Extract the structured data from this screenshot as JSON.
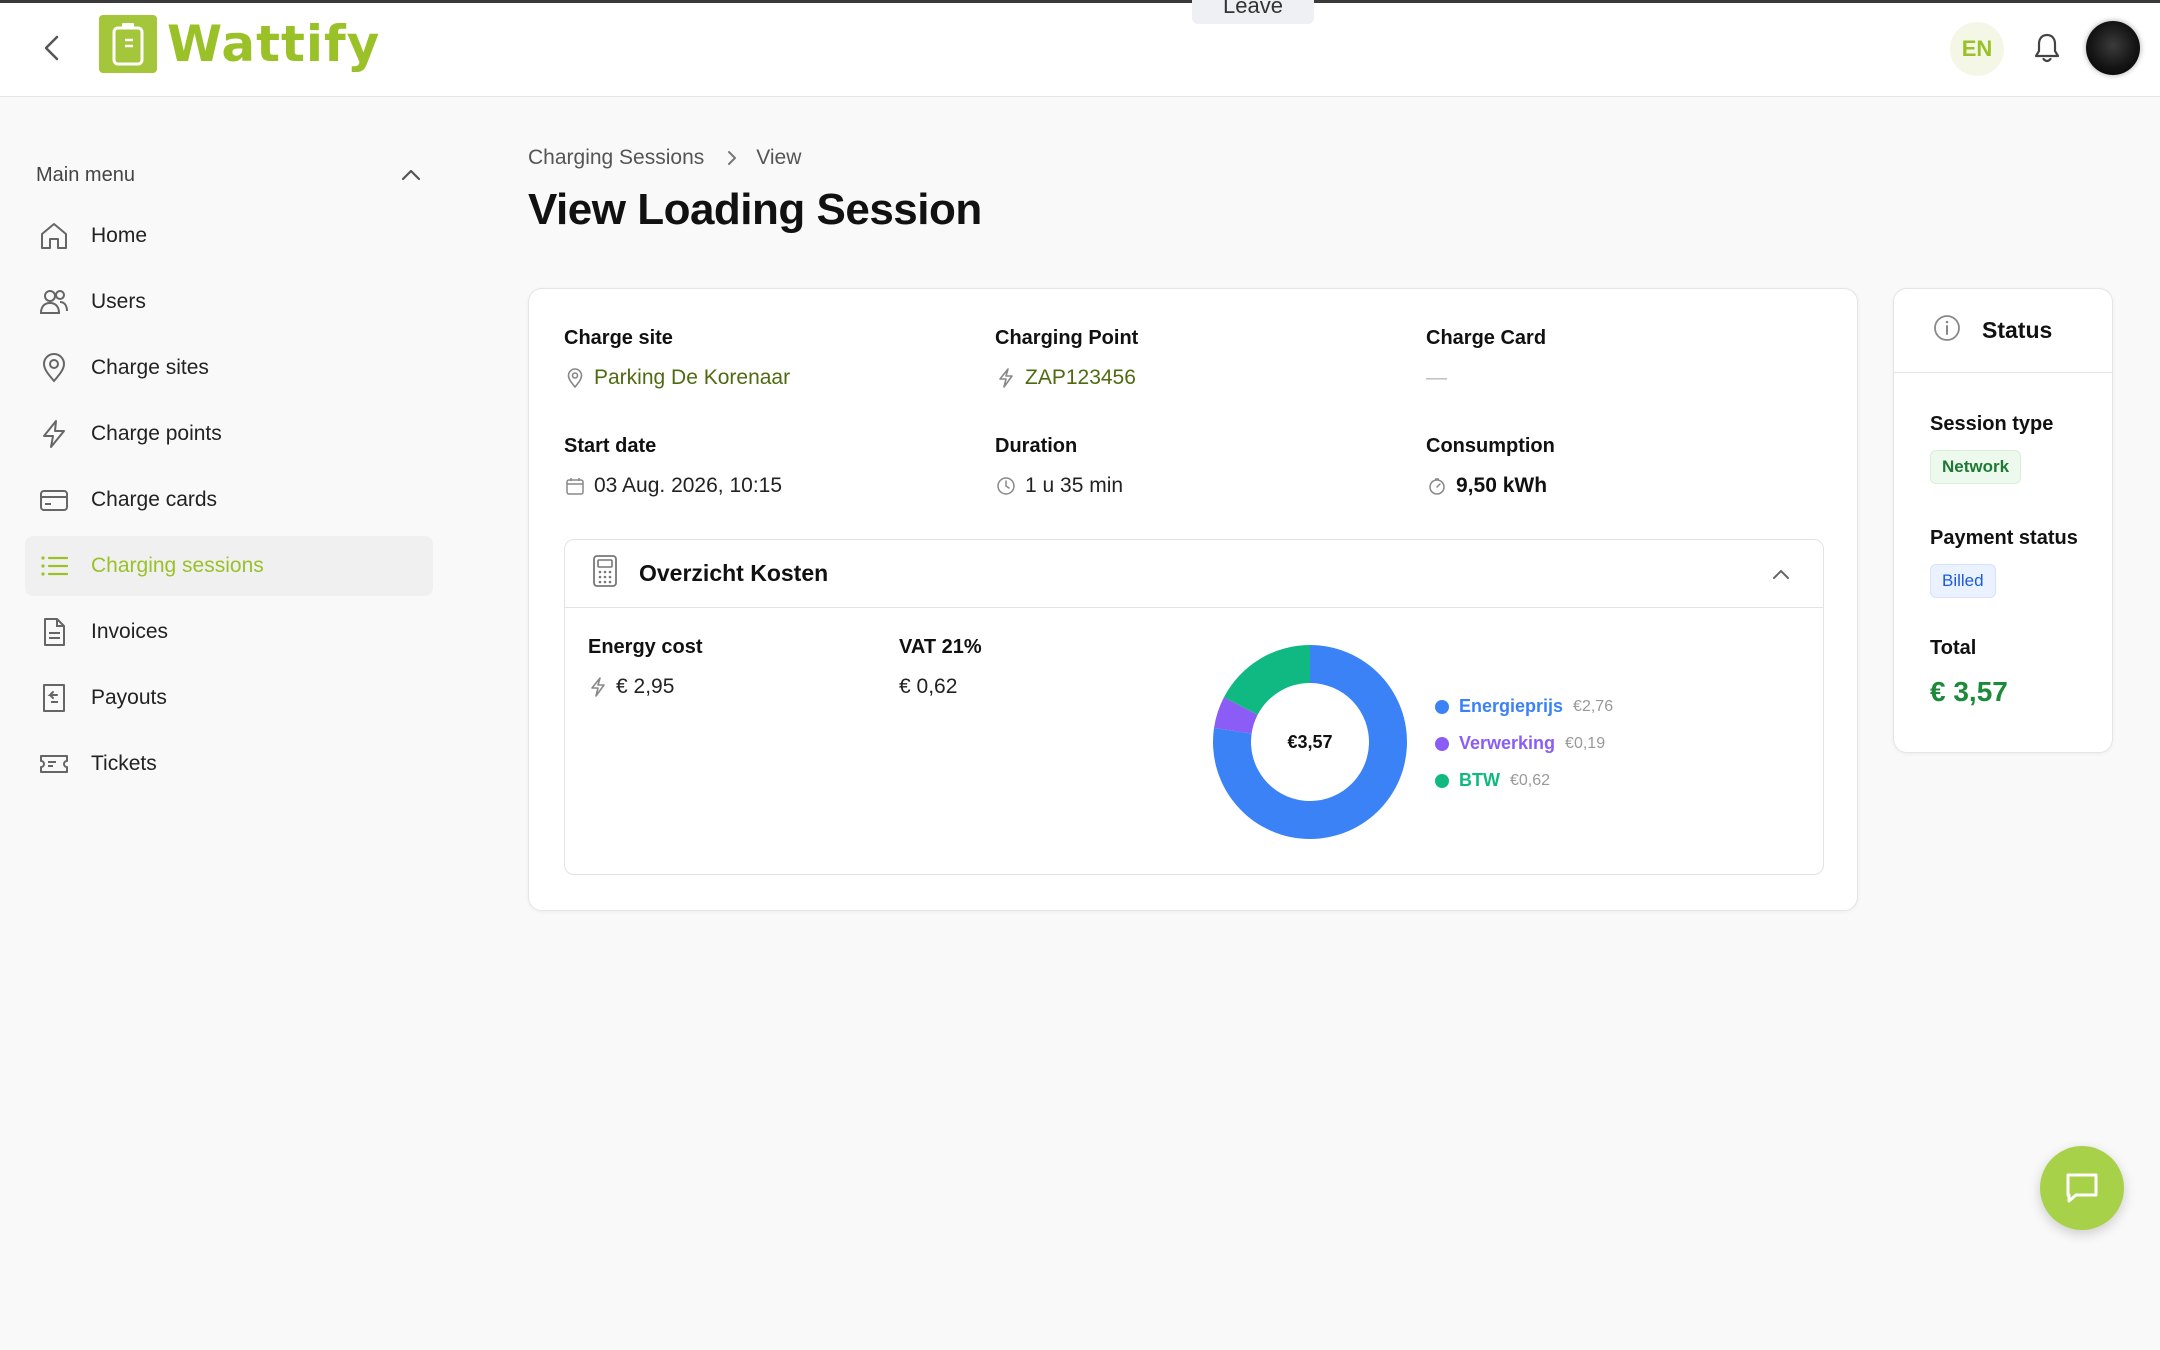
{
  "meeting_bar": {
    "leave_label": "Leave"
  },
  "app": {
    "name": "Wattify"
  },
  "header": {
    "language": "EN"
  },
  "sidebar": {
    "title": "Main menu",
    "items": [
      {
        "label": "Home",
        "icon": "home-icon"
      },
      {
        "label": "Users",
        "icon": "users-icon"
      },
      {
        "label": "Charge sites",
        "icon": "map-pin-icon"
      },
      {
        "label": "Charge points",
        "icon": "bolt-icon"
      },
      {
        "label": "Charge cards",
        "icon": "credit-card-icon"
      },
      {
        "label": "Charging sessions",
        "icon": "list-icon",
        "active": true
      },
      {
        "label": "Invoices",
        "icon": "document-icon"
      },
      {
        "label": "Payouts",
        "icon": "receipt-icon"
      },
      {
        "label": "Tickets",
        "icon": "ticket-icon"
      }
    ]
  },
  "breadcrumb": {
    "parent": "Charging Sessions",
    "current": "View"
  },
  "page": {
    "title": "View Loading Session"
  },
  "session": {
    "charge_site": {
      "label": "Charge site",
      "value": "Parking De Korenaar"
    },
    "charging_point": {
      "label": "Charging Point",
      "value": "ZAP123456"
    },
    "charge_card": {
      "label": "Charge Card",
      "value": "—"
    },
    "start_date": {
      "label": "Start date",
      "value": "03 Aug. 2026, 10:15"
    },
    "duration": {
      "label": "Duration",
      "value": "1 u 35 min"
    },
    "consumption": {
      "label": "Consumption",
      "value": "9,50 kWh"
    }
  },
  "costs": {
    "title": "Overzicht Kosten",
    "energy_cost": {
      "label": "Energy cost",
      "value": "€ 2,95"
    },
    "vat": {
      "label": "VAT 21%",
      "value": "€ 0,62"
    },
    "total_center": "€3,57"
  },
  "chart_data": {
    "type": "pie",
    "categories": [
      "Energieprijs",
      "Verwerking",
      "BTW"
    ],
    "values": [
      2.76,
      0.19,
      0.62
    ],
    "value_labels": [
      "€2,76",
      "€0,19",
      "€0,62"
    ],
    "colors": [
      "#3b82f6",
      "#8b5cf6",
      "#10b981"
    ],
    "center_label": "€3,57"
  },
  "status": {
    "title": "Status",
    "session_type": {
      "label": "Session type",
      "value": "Network"
    },
    "payment_status": {
      "label": "Payment status",
      "value": "Billed"
    },
    "total": {
      "label": "Total",
      "value": "€ 3,57"
    }
  }
}
